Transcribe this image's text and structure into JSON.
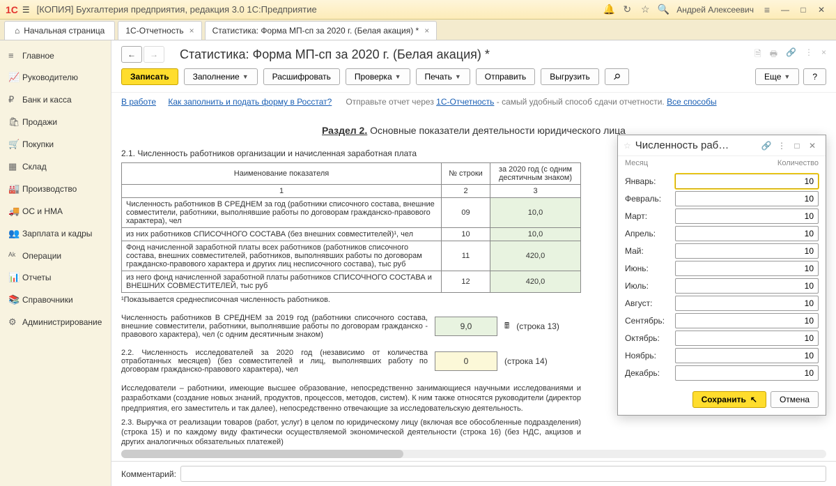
{
  "titlebar": {
    "logo": "1С",
    "title": "[КОПИЯ] Бухгалтерия предприятия, редакция 3.0  1С:Предприятие",
    "user": "Андрей Алексеевич"
  },
  "tabs": {
    "home": "Начальная страница",
    "items": [
      {
        "label": "1С-Отчетность"
      },
      {
        "label": "Статистика: Форма МП-сп за 2020 г. (Белая акация) *"
      }
    ]
  },
  "sidebar": {
    "items": [
      {
        "icon": "≡",
        "label": "Главное"
      },
      {
        "icon": "📈",
        "label": "Руководителю"
      },
      {
        "icon": "₽",
        "label": "Банк и касса"
      },
      {
        "icon": "🛍",
        "label": "Продажи"
      },
      {
        "icon": "🛒",
        "label": "Покупки"
      },
      {
        "icon": "▦",
        "label": "Склад"
      },
      {
        "icon": "🏭",
        "label": "Производство"
      },
      {
        "icon": "🚚",
        "label": "ОС и НМА"
      },
      {
        "icon": "👥",
        "label": "Зарплата и кадры"
      },
      {
        "icon": "ᴬᵏ",
        "label": "Операции"
      },
      {
        "icon": "📊",
        "label": "Отчеты"
      },
      {
        "icon": "📚",
        "label": "Справочники"
      },
      {
        "icon": "⚙",
        "label": "Администрирование"
      }
    ]
  },
  "page": {
    "title": "Статистика: Форма МП-сп за 2020 г. (Белая акация) *",
    "toolbar": {
      "write": "Записать",
      "fill": "Заполнение",
      "decode": "Расшифровать",
      "check": "Проверка",
      "print": "Печать",
      "send": "Отправить",
      "export": "Выгрузить",
      "more": "Еще",
      "help": "?"
    },
    "infobar": {
      "status": "В работе",
      "howto": "Как заполнить и подать форму в Росстат?",
      "hint_pre": "Отправьте отчет через ",
      "hint_link": "1С-Отчетность",
      "hint_post": " - самый удобный способ сдачи отчетности. ",
      "all_ways": "Все способы"
    }
  },
  "form": {
    "section_num": "Раздел 2.",
    "section_title": " Основные показатели деятельности юридического лица",
    "p21": "2.1. Численность работников организации и начисленная заработная плата",
    "th_name": "Наименование показателя",
    "th_row": "№ строки",
    "th_val": "за 2020 год (с одним десятичным знаком)",
    "colnums": [
      "1",
      "2",
      "3"
    ],
    "rows": [
      {
        "name": "Численность работников В СРЕДНЕМ за год (работники списочного состава, внешние совместители, работники, выполнявшие работы по договорам гражданско-правового характера), чел",
        "num": "09",
        "val": "10,0"
      },
      {
        "name": "   из них работников СПИСОЧНОГО СОСТАВА (без внешних совместителей)¹, чел",
        "num": "10",
        "val": "10,0"
      },
      {
        "name": "Фонд начисленной заработной платы всех работников  (работников списочного состава, внешних совместителей, работников, выполнявших работы по договорам гражданско-правового характера и других лиц несписочного состава), тыс руб",
        "num": "11",
        "val": "420,0"
      },
      {
        "name": "   из него фонд начисленной заработной платы работников СПИСОЧНОГО СОСТАВА и ВНЕШНИХ СОВМЕСТИТЕЛЕЙ, тыс руб",
        "num": "12",
        "val": "420,0"
      }
    ],
    "footnote": "¹Показывается среднесписочная численность работников.",
    "block2019": {
      "text": "Численность работников В СРЕДНЕМ за 2019 год (работники списочного состава, внешние совместители, работники, выполнявшие работы по договорам гражданско - правового характера), чел (с одним десятичным знаком)",
      "val": "9,0",
      "ref": "(строка 13)"
    },
    "block22": {
      "text": "2.2. Численность исследователей за 2020 год (независимо от количества отработанных месяцев) (без совместителей и лиц, выполнявших работу по договорам гражданско-правового характера), чел",
      "val": "0",
      "ref": "(строка 14)"
    },
    "para22b": "Исследователи – работники, имеющие высшее образование, непосредственно занимающиеся научными исследованиями и разработками (создание новых знаний, продуктов, процессов, методов, систем). К ним также относятся руководители (директор предприятия, его заместитель и так далее), непосредственно отвечающие за исследовательскую деятельность.",
    "para23": "2.3. Выручка от реализации товаров (работ, услуг) в целом по юридическому лицу (включая все обособленные подразделения) (строка 15) и по каждому виду фактически осуществляемой экономической деятельности (строка 16) (без НДС, акцизов и других аналогичных обязательных платежей)"
  },
  "popup": {
    "title": "Численность раб…",
    "col_month": "Месяц",
    "col_qty": "Количество",
    "months": [
      {
        "label": "Январь:",
        "val": "10"
      },
      {
        "label": "Февраль:",
        "val": "10"
      },
      {
        "label": "Март:",
        "val": "10"
      },
      {
        "label": "Апрель:",
        "val": "10"
      },
      {
        "label": "Май:",
        "val": "10"
      },
      {
        "label": "Июнь:",
        "val": "10"
      },
      {
        "label": "Июль:",
        "val": "10"
      },
      {
        "label": "Август:",
        "val": "10"
      },
      {
        "label": "Сентябрь:",
        "val": "10"
      },
      {
        "label": "Октябрь:",
        "val": "10"
      },
      {
        "label": "Ноябрь:",
        "val": "10"
      },
      {
        "label": "Декабрь:",
        "val": "10"
      }
    ],
    "save": "Сохранить",
    "cancel": "Отмена"
  },
  "comment_label": "Комментарий:"
}
